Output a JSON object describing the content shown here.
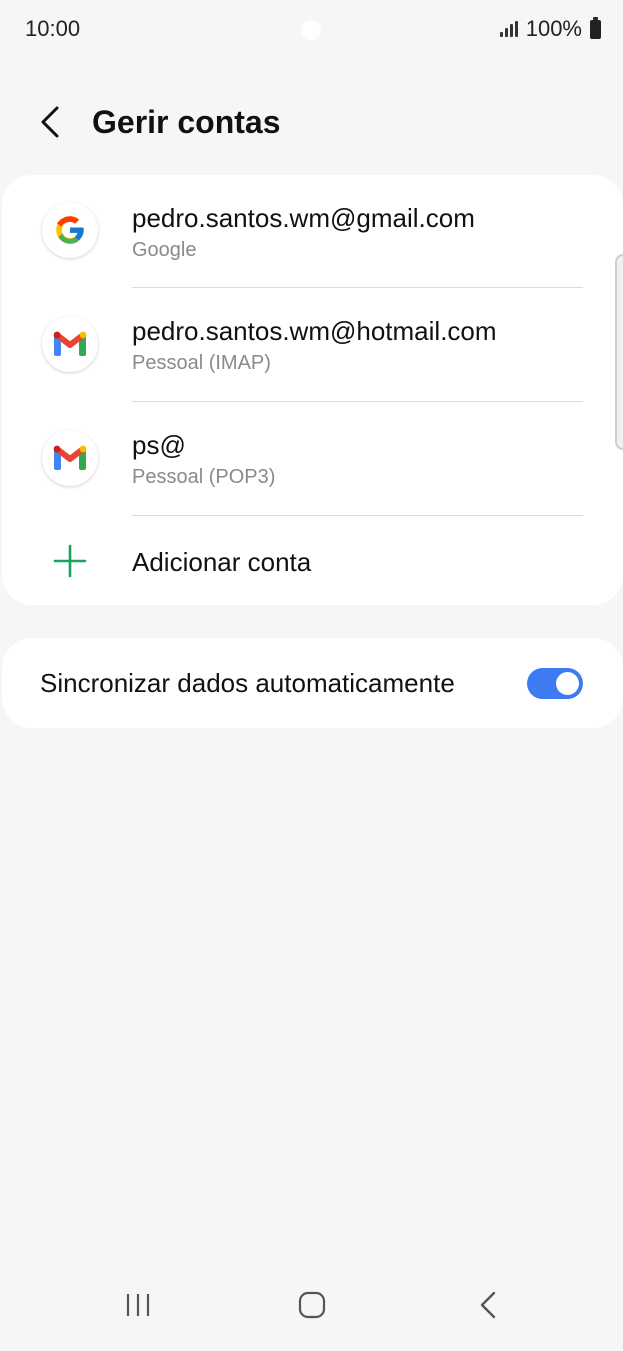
{
  "status_bar": {
    "time": "10:00",
    "battery": "100%"
  },
  "header": {
    "title": "Gerir contas"
  },
  "accounts": [
    {
      "title": "pedro.santos.wm@gmail.com",
      "subtitle": "Google",
      "icon": "google-icon"
    },
    {
      "title": "pedro.santos.wm@hotmail.com",
      "subtitle": "Pessoal (IMAP)",
      "icon": "gmail-icon"
    },
    {
      "title": "ps@",
      "subtitle": "Pessoal (POP3)",
      "icon": "gmail-icon"
    }
  ],
  "add_account": {
    "label": "Adicionar conta",
    "icon": "plus-icon",
    "color": "#1aa260"
  },
  "sync": {
    "label": "Sincronizar dados automaticamente",
    "enabled": true,
    "toggle_color": "#3e7bf2"
  },
  "nav_bar": {
    "recents_icon": "recents-icon",
    "home_icon": "home-icon",
    "back_icon": "back-icon"
  }
}
